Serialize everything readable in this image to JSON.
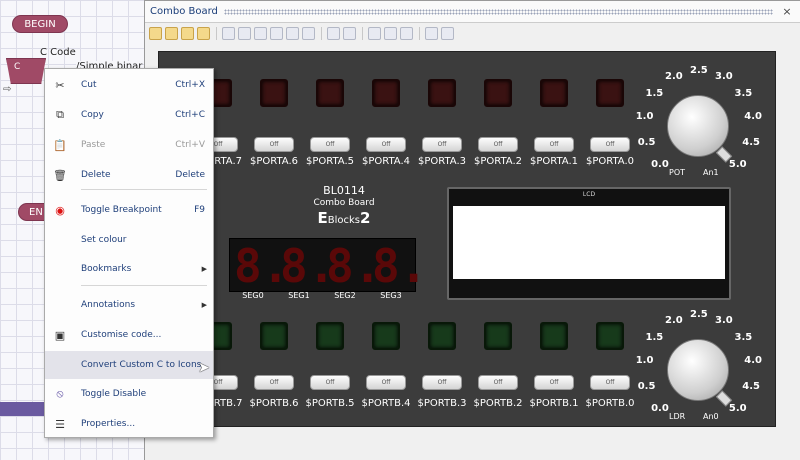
{
  "flowchart": {
    "begin": "BEGIN",
    "end": "EN",
    "ccode_label": "C Code",
    "ccode_block_text": "C",
    "comment_text": "/Simple binar"
  },
  "panel": {
    "title": "Combo Board",
    "close": "×"
  },
  "board": {
    "title": "BL0114",
    "subtitle": "Combo Board",
    "brand_prefix": "E",
    "brand_main": "Blocks",
    "brand_suffix": "2",
    "switch_label": "Off",
    "porta": [
      "$PORTA.7",
      "$PORTA.6",
      "$PORTA.5",
      "$PORTA.4",
      "$PORTA.3",
      "$PORTA.2",
      "$PORTA.1",
      "$PORTA.0"
    ],
    "portb": [
      "$PORTB.7",
      "$PORTB.6",
      "$PORTB.5",
      "$PORTB.4",
      "$PORTB.3",
      "$PORTB.2",
      "$PORTB.1",
      "$PORTB.0"
    ],
    "seg_digits": [
      "8.",
      "8.",
      "8.",
      "8."
    ],
    "seg_labels": [
      "SEG0",
      "SEG1",
      "SEG2",
      "SEG3"
    ],
    "lcd_label": "LCD",
    "pot": {
      "ticks": [
        "0.0",
        "0.5",
        "1.0",
        "1.5",
        "2.0",
        "2.5",
        "3.0",
        "3.5",
        "4.0",
        "4.5",
        "5.0"
      ],
      "name": "POT",
      "channel": "An1"
    },
    "ldr": {
      "ticks": [
        "0.0",
        "0.5",
        "1.0",
        "1.5",
        "2.0",
        "2.5",
        "3.0",
        "3.5",
        "4.0",
        "4.5",
        "5.0"
      ],
      "name": "LDR",
      "channel": "An0"
    }
  },
  "menu": {
    "items": [
      {
        "label": "Cut",
        "shortcut": "Ctrl+X",
        "icon": "scissors-icon"
      },
      {
        "label": "Copy",
        "shortcut": "Ctrl+C",
        "icon": "copy-icon"
      },
      {
        "label": "Paste",
        "shortcut": "Ctrl+V",
        "icon": "paste-icon",
        "disabled": true
      },
      {
        "label": "Delete",
        "shortcut": "Delete",
        "icon": "trash-icon"
      },
      {
        "label": "Toggle Breakpoint",
        "shortcut": "F9",
        "icon": "breakpoint-icon"
      },
      {
        "label": "Set colour",
        "shortcut": ""
      },
      {
        "label": "Bookmarks",
        "shortcut": "",
        "submenu": true
      },
      {
        "label": "Annotations",
        "shortcut": "",
        "submenu": true
      },
      {
        "label": "Customise code...",
        "shortcut": "",
        "icon": "code-icon"
      },
      {
        "label": "Convert Custom C to Icons",
        "shortcut": "",
        "highlighted": true
      },
      {
        "label": "Toggle Disable",
        "shortcut": "",
        "icon": "disable-icon"
      },
      {
        "label": "Properties...",
        "shortcut": "",
        "icon": "properties-icon"
      }
    ]
  },
  "colors": {
    "flow_block": "#a04a66",
    "board_bg": "#3c3c3c",
    "menu_text": "#1f3f7a"
  }
}
